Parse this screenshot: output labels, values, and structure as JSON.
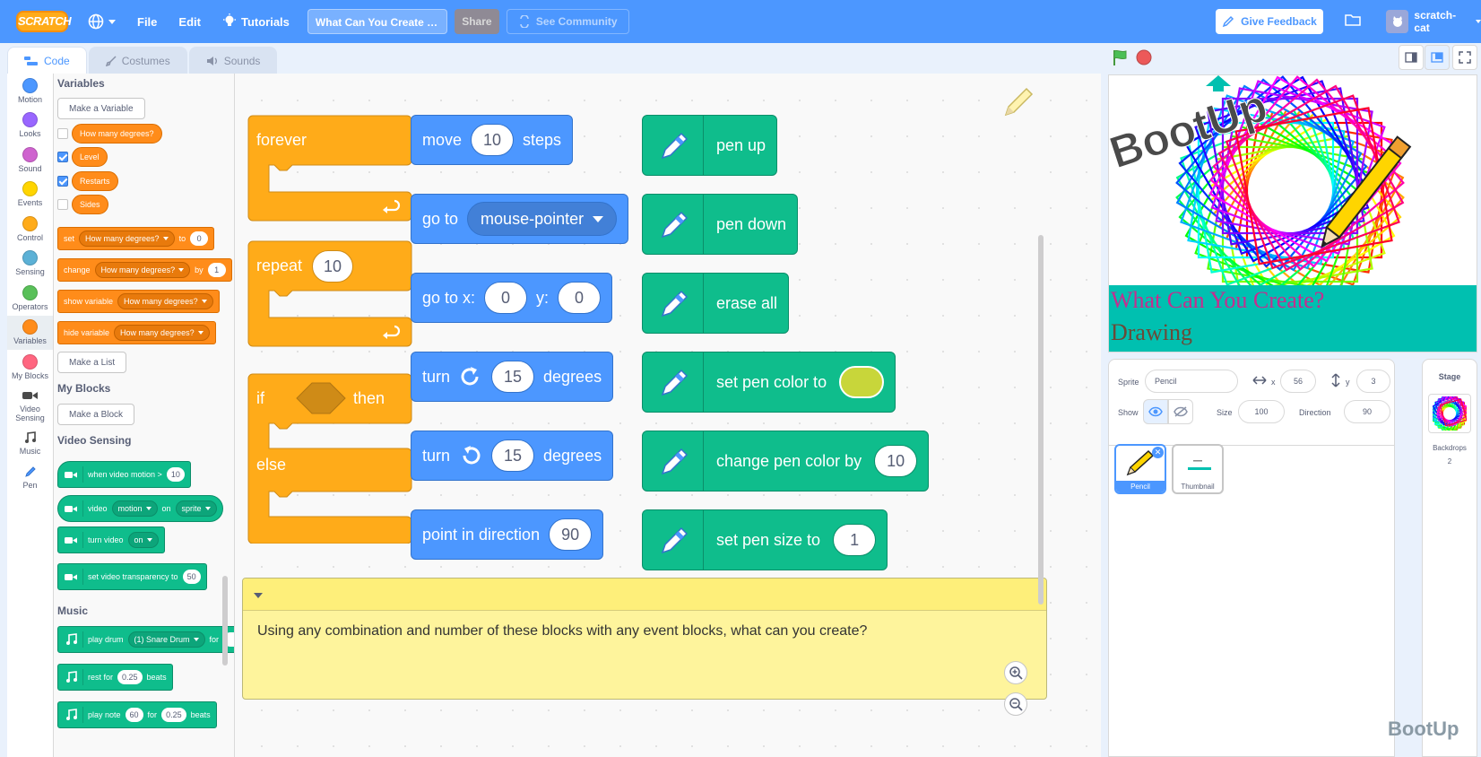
{
  "menubar": {
    "logo": "SCRATCH",
    "file": "File",
    "edit": "Edit",
    "tutorials": "Tutorials",
    "project_title": "What Can You Create - D...",
    "share": "Share",
    "see_community": "See Community",
    "give_feedback": "Give Feedback",
    "username": "scratch-cat"
  },
  "tabs": [
    "Code",
    "Costumes",
    "Sounds"
  ],
  "categories": [
    {
      "label": "Motion",
      "color": "#4c97ff"
    },
    {
      "label": "Looks",
      "color": "#9966ff"
    },
    {
      "label": "Sound",
      "color": "#cf63cf"
    },
    {
      "label": "Events",
      "color": "#ffd500"
    },
    {
      "label": "Control",
      "color": "#ffab19"
    },
    {
      "label": "Sensing",
      "color": "#5cb1d6"
    },
    {
      "label": "Operators",
      "color": "#59c059"
    },
    {
      "label": "Variables",
      "color": "#ff8c1a"
    },
    {
      "label": "My Blocks",
      "color": "#ff6680"
    }
  ],
  "ext_categories": [
    "Video Sensing",
    "Music",
    "Pen"
  ],
  "palette": {
    "variables_header": "Variables",
    "make_variable": "Make a Variable",
    "variables": [
      "How many degrees?",
      "Level",
      "Restarts",
      "Sides"
    ],
    "set": "set",
    "to": "to",
    "zero": "0",
    "change": "change",
    "by": "by",
    "one": "1",
    "show_variable": "show variable",
    "hide_variable": "hide variable",
    "var_name": "How many degrees?",
    "make_list": "Make a List",
    "myblocks_header": "My Blocks",
    "make_block": "Make a Block",
    "video_header": "Video Sensing",
    "when_video_motion": "when video motion >",
    "ten": "10",
    "video": "video",
    "motion": "motion",
    "on": "on",
    "sprite": "sprite",
    "turn_video": "turn video",
    "on_opt": "on",
    "set_video_transparency": "set video transparency to",
    "fifty": "50",
    "music_header": "Music",
    "play_drum": "play drum",
    "snare": "(1) Snare Drum",
    "for": "for",
    "rest_for": "rest for",
    "rest_val": "0.25",
    "beats": "beats",
    "play_note": "play note",
    "note_val": "60",
    "for2": "for",
    "note_beats": "0.25",
    "beats2": "beats"
  },
  "script": {
    "forever": "forever",
    "repeat": "repeat",
    "repeat_val": "10",
    "if": "if",
    "then": "then",
    "else": "else",
    "move": "move",
    "move_val": "10",
    "steps": "steps",
    "goto": "go to",
    "goto_target": "mouse-pointer",
    "gotoxy": "go to x:",
    "x_val": "0",
    "y_label": "y:",
    "y_val": "0",
    "turn": "turn",
    "turn_val1": "15",
    "turn_val2": "15",
    "degrees": "degrees",
    "point": "point in direction",
    "point_val": "90",
    "pen_up": "pen up",
    "pen_down": "pen down",
    "erase_all": "erase all",
    "set_pen_color": "set pen color to",
    "pen_color": "#c8d63a",
    "change_pen_color": "change pen color by",
    "change_val": "10",
    "set_pen_size": "set pen size to",
    "size_val": "1",
    "comment": "Using any combination and number of these blocks with any event blocks, what can you create?"
  },
  "stage": {
    "logo_text": "BootUp",
    "title_line1": "What Can You Create?",
    "title_line2": "Drawing"
  },
  "sprite_info": {
    "sprite_label": "Sprite",
    "sprite_name": "Pencil",
    "x_label": "x",
    "x_val": "56",
    "y_label": "y",
    "y_val": "3",
    "show_label": "Show",
    "size_label": "Size",
    "size_val": "100",
    "direction_label": "Direction",
    "direction_val": "90"
  },
  "sprites": [
    "Pencil",
    "Thumbnail"
  ],
  "stage_pane": {
    "title": "Stage",
    "backdrops_label": "Backdrops",
    "backdrops_count": "2"
  },
  "watermark": "BootUp"
}
